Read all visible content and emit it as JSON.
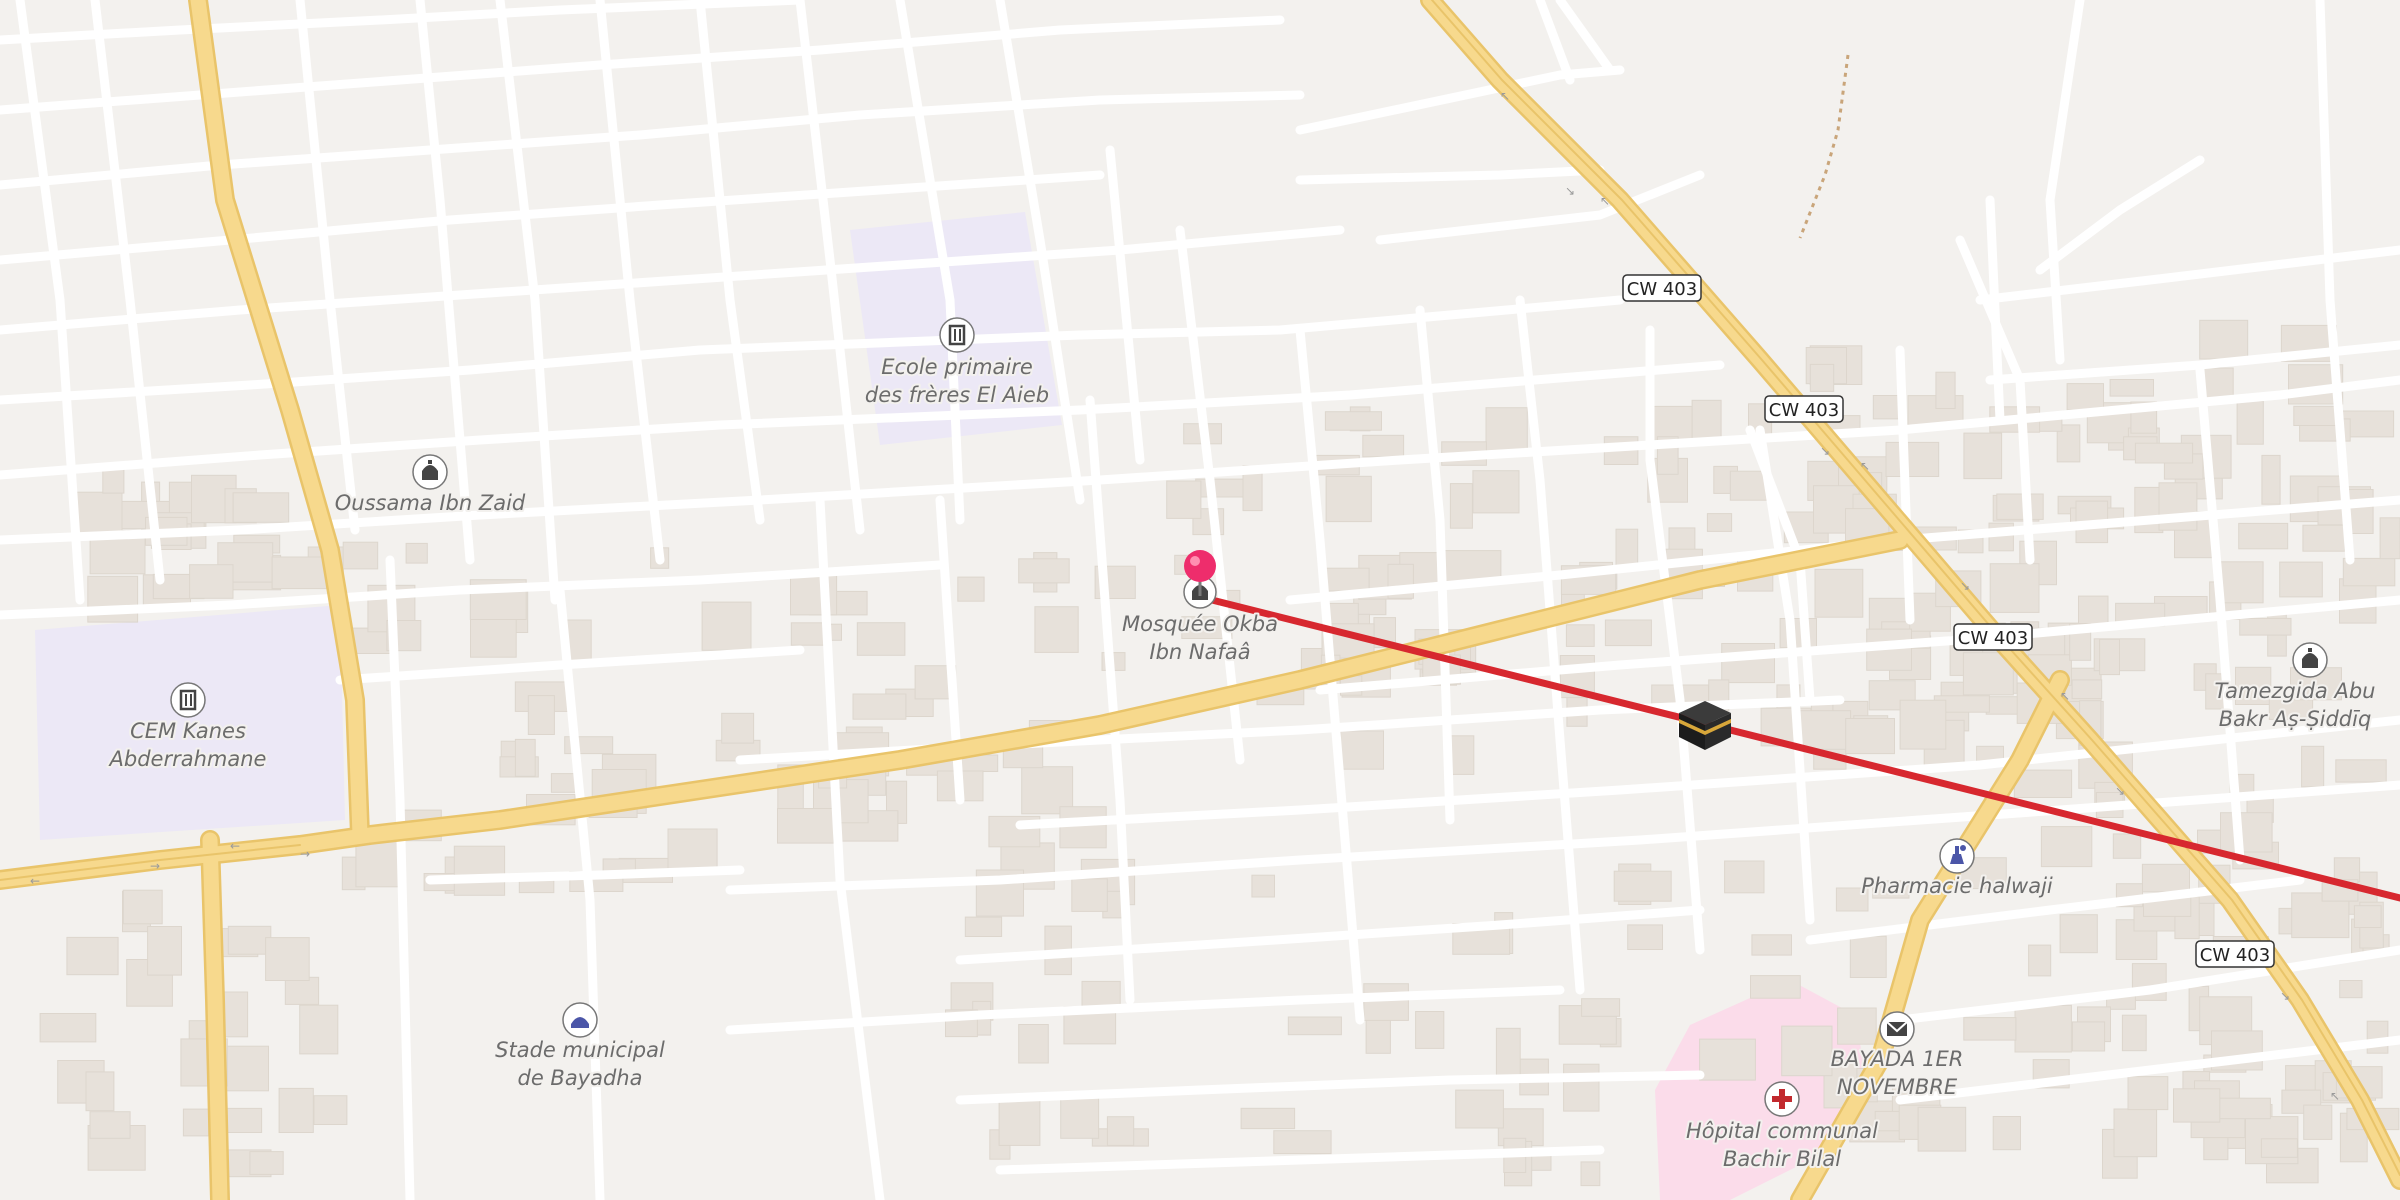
{
  "map": {
    "road_refs": [
      "CW 403",
      "CW 403",
      "CW 403",
      "CW 403"
    ],
    "places": {
      "ecole_primaire": [
        "Ecole primaire",
        "des frères El Aieb"
      ],
      "oussama": [
        "Oussama Ibn Zaid"
      ],
      "mosquee_okba": [
        "Mosquée Okba",
        "Ibn Nafaâ"
      ],
      "cem_kanes": [
        "CEM Kanes",
        "Abderrahmane"
      ],
      "tamezgida": [
        "Tamezgida Abu",
        "Bakr Aṣ-Ṣiddīq"
      ],
      "pharmacie": [
        "Pharmacie halwaji"
      ],
      "stade": [
        "Stade municipal",
        "de Bayadha"
      ],
      "bayada_post": [
        "BAYADA 1ER",
        "NOVEMBRE"
      ],
      "hopital": [
        "Hôpital communal",
        "Bachir Bilal"
      ]
    },
    "icons": {
      "school": "school-icon",
      "mosque": "mosque-icon",
      "kaaba": "kaaba-icon",
      "pharmacy": "pharmacy-icon",
      "stadium": "stadium-icon",
      "post": "post-office-icon",
      "hospital": "hospital-icon",
      "pin": "location-pin-icon"
    },
    "colors": {
      "background": "#f3f1ee",
      "street": "#ffffff",
      "primary_road": "#f7d98d",
      "primary_road_casing": "#e9c46a",
      "building": "#e7e1da",
      "school_area": "#ece8f6",
      "hospital_area": "#fbdcea",
      "qibla_line": "#d7282f",
      "pin": "#ee2d6c"
    }
  }
}
